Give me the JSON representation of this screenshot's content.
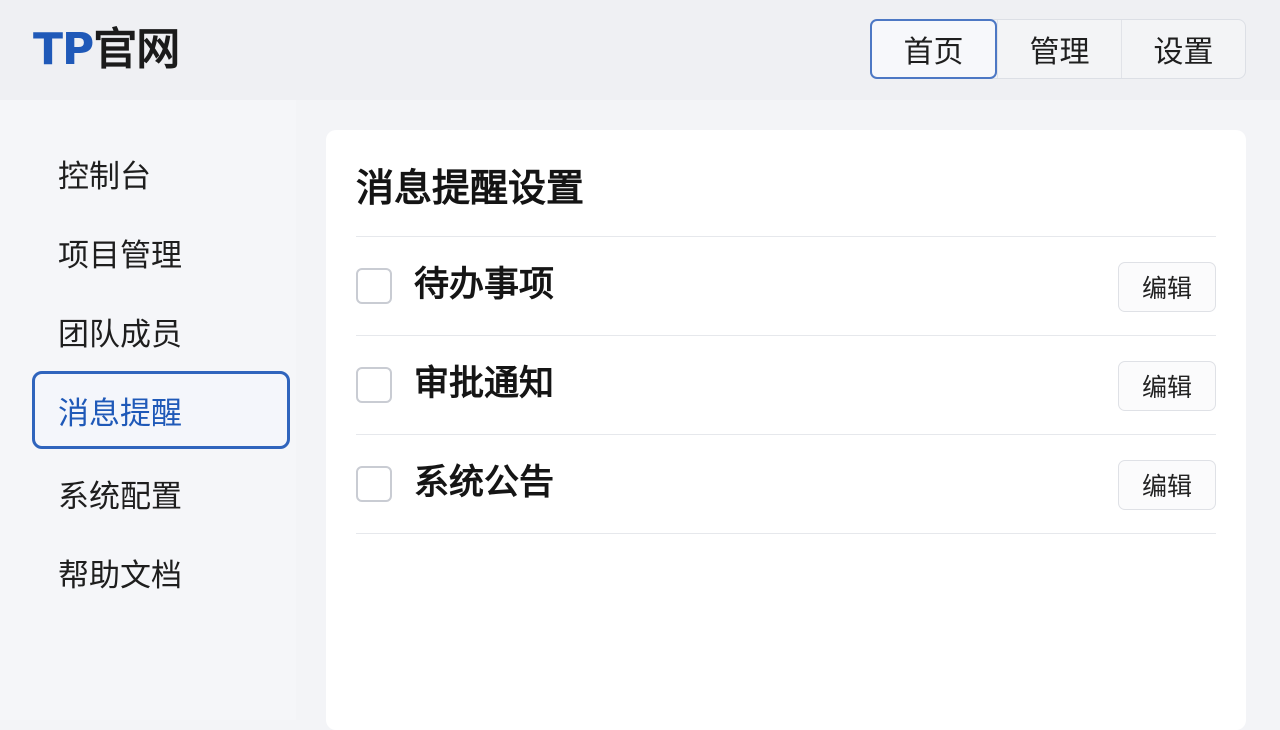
{
  "header": {
    "logo_brand": "TP",
    "logo_rest": "官网",
    "tabs": [
      {
        "label": "首页",
        "active": true
      },
      {
        "label": "管理",
        "active": false
      },
      {
        "label": "设置",
        "active": false
      }
    ]
  },
  "sidebar": {
    "items": [
      {
        "label": "控制台"
      },
      {
        "label": "项目管理"
      },
      {
        "label": "团队成员"
      },
      {
        "label": "消息提醒",
        "active": true
      },
      {
        "label": "系统配置"
      },
      {
        "label": "帮助文档"
      }
    ]
  },
  "main": {
    "title": "消息提醒设置",
    "rows": [
      {
        "label": "待办事项",
        "checked": false,
        "edit_label": "编辑"
      },
      {
        "label": "审批通知",
        "checked": false,
        "edit_label": "编辑"
      },
      {
        "label": "系统公告",
        "checked": false,
        "edit_label": "编辑"
      }
    ]
  },
  "colors": {
    "accent": "#1f59b8",
    "active_border": "#2f64bd"
  }
}
